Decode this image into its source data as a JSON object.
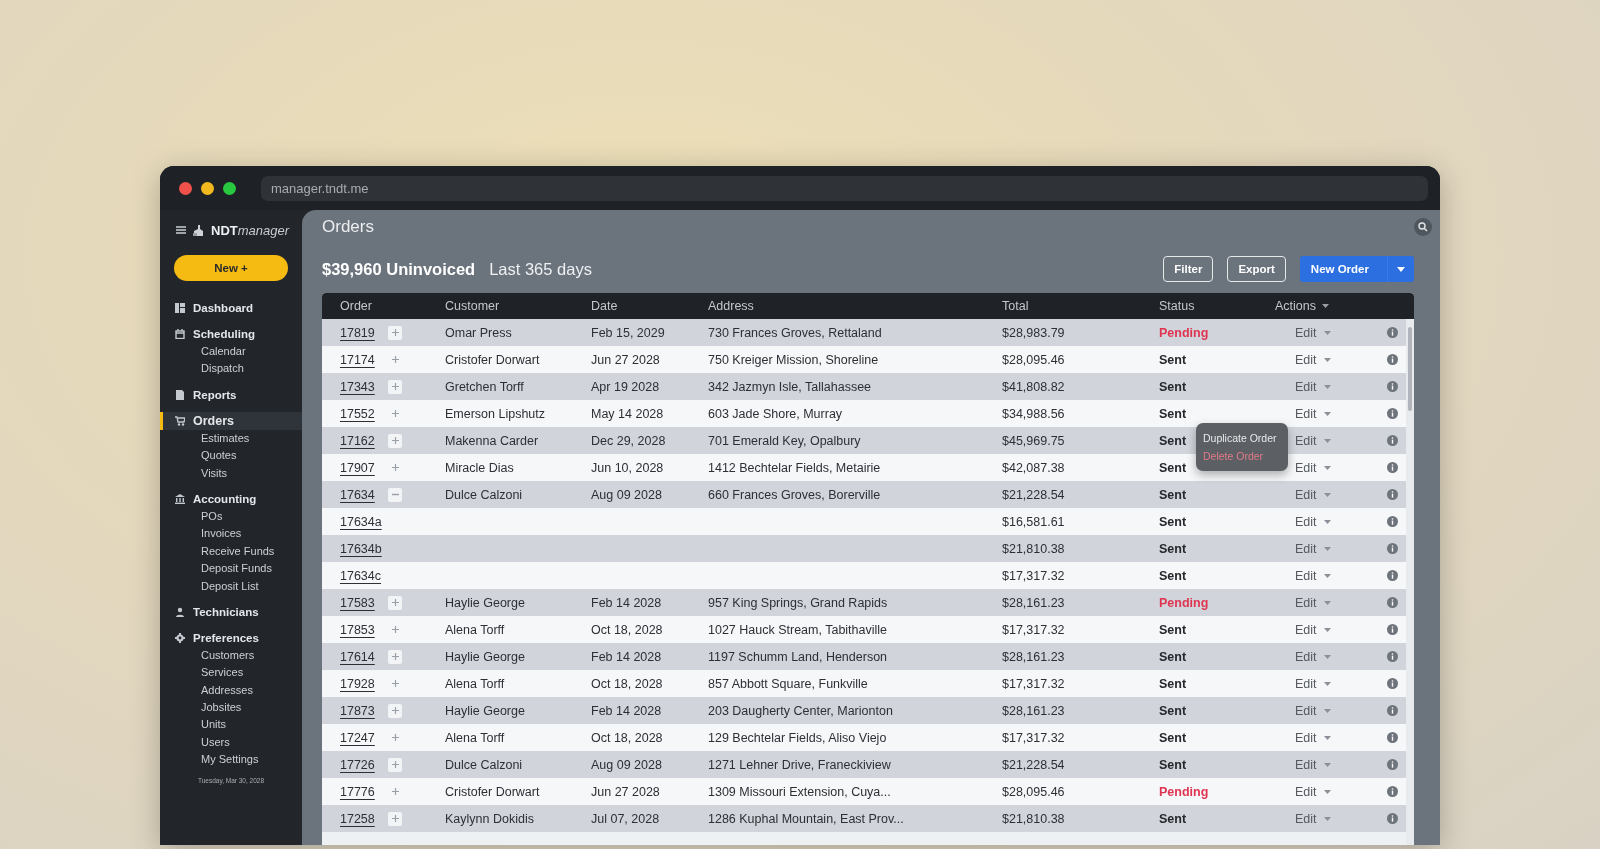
{
  "browser": {
    "address": "manager.tndt.me"
  },
  "sidebar": {
    "brand_bold": "NDT",
    "brand_italic": "manager",
    "new_button": "New +",
    "sections": [
      {
        "kind": "dashboard",
        "label": "Dashboard",
        "selected": false
      },
      {
        "kind": "calendar",
        "label": "Scheduling",
        "selected": false,
        "children": [
          "Calendar",
          "Dispatch"
        ]
      },
      {
        "kind": "report",
        "label": "Reports",
        "selected": false
      },
      {
        "kind": "cart",
        "label": "Orders",
        "selected": true,
        "children": [
          "Estimates",
          "Quotes",
          "Visits"
        ]
      },
      {
        "kind": "bank",
        "label": "Accounting",
        "selected": false,
        "children": [
          "POs",
          "Invoices",
          "Receive Funds",
          "Deposit Funds",
          "Deposit List"
        ]
      },
      {
        "kind": "person",
        "label": "Technicians",
        "selected": false
      },
      {
        "kind": "gear",
        "label": "Preferences",
        "selected": false,
        "children": [
          "Customers",
          "Services",
          "Addresses",
          "Jobsites",
          "Units",
          "Users",
          "My Settings"
        ]
      }
    ],
    "date": "Tuesday, Mar 30, 2028"
  },
  "page": {
    "title": "Orders",
    "summary": "$39,960 Uninvoiced",
    "period": "Last 365 days",
    "buttons": [
      "Filter",
      "Export"
    ],
    "primary_button": "New Order"
  },
  "table": {
    "columns": [
      "Order",
      "Customer",
      "Date",
      "Address",
      "Total",
      "Status",
      "Actions"
    ],
    "rows": [
      {
        "kind": "order",
        "order": "17819",
        "expanded": false,
        "customer": "Omar Press",
        "date": "Feb 15, 2029",
        "address": "730 Frances Groves, Rettaland",
        "total": "$28,983.79",
        "status": "Pending",
        "pending": true,
        "action": "Edit"
      },
      {
        "kind": "order",
        "order": "17174",
        "expanded": false,
        "customer": "Cristofer Dorwart",
        "date": "Jun 27 2028",
        "address": "750 Kreiger Mission, Shoreline",
        "total": "$28,095.46",
        "status": "Sent",
        "pending": false,
        "action": "Edit"
      },
      {
        "kind": "order",
        "order": "17343",
        "expanded": false,
        "customer": "Gretchen Torff",
        "date": "Apr 19 2028",
        "address": "342 Jazmyn Isle, Tallahassee",
        "total": "$41,808.82",
        "status": "Sent",
        "pending": false,
        "action": "Edit"
      },
      {
        "kind": "order",
        "order": "17552",
        "expanded": false,
        "customer": "Emerson Lipshutz",
        "date": "May 14 2028",
        "address": "603 Jade Shore, Murray",
        "total": "$34,988.56",
        "status": "Sent",
        "pending": false,
        "action": "Edit"
      },
      {
        "kind": "order",
        "order": "17162",
        "expanded": false,
        "customer": "Makenna Carder",
        "date": "Dec 29, 2028",
        "address": "701 Emerald Key, Opalbury",
        "total": "$45,969.75",
        "status": "Sent",
        "pending": false,
        "action": "Edit"
      },
      {
        "kind": "order",
        "order": "17907",
        "expanded": false,
        "customer": "Miracle Dias",
        "date": "Jun 10, 2028",
        "address": "1412 Bechtelar Fields, Metairie",
        "total": "$42,087.38",
        "status": "Sent",
        "pending": false,
        "action": "Edit"
      },
      {
        "kind": "order",
        "order": "17634",
        "expanded": true,
        "customer": "Dulce Calzoni",
        "date": "Aug 09 2028",
        "address": "660 Frances Groves, Borerville",
        "total": "$21,228.54",
        "status": "Sent",
        "pending": false,
        "action": "Edit"
      },
      {
        "kind": "sub",
        "order": "17634a",
        "total": "$16,581.61",
        "status": "Sent",
        "pending": false,
        "action": "Edit"
      },
      {
        "kind": "sub",
        "order": "17634b",
        "total": "$21,810.38",
        "status": "Sent",
        "pending": false,
        "action": "Edit"
      },
      {
        "kind": "sub",
        "order": "17634c",
        "total": "$17,317.32",
        "status": "Sent",
        "pending": false,
        "action": "Edit"
      },
      {
        "kind": "order",
        "order": "17583",
        "expanded": false,
        "customer": "Haylie George",
        "date": "Feb 14 2028",
        "address": "957 King Springs, Grand Rapids",
        "total": "$28,161.23",
        "status": "Pending",
        "pending": true,
        "action": "Edit"
      },
      {
        "kind": "order",
        "order": "17853",
        "expanded": false,
        "customer": "Alena Torff",
        "date": "Oct 18, 2028",
        "address": "1027 Hauck Stream, Tabithaville",
        "total": "$17,317.32",
        "status": "Sent",
        "pending": false,
        "action": "Edit"
      },
      {
        "kind": "order",
        "order": "17614",
        "expanded": false,
        "customer": "Haylie George",
        "date": "Feb 14 2028",
        "address": "1197 Schumm Land, Henderson",
        "total": "$28,161.23",
        "status": "Sent",
        "pending": false,
        "action": "Edit"
      },
      {
        "kind": "order",
        "order": "17928",
        "expanded": false,
        "customer": "Alena Torff",
        "date": "Oct 18, 2028",
        "address": "857 Abbott Square, Funkville",
        "total": "$17,317.32",
        "status": "Sent",
        "pending": false,
        "action": "Edit"
      },
      {
        "kind": "order",
        "order": "17873",
        "expanded": false,
        "customer": "Haylie George",
        "date": "Feb 14 2028",
        "address": "203 Daugherty Center, Marionton",
        "total": "$28,161.23",
        "status": "Sent",
        "pending": false,
        "action": "Edit"
      },
      {
        "kind": "order",
        "order": "17247",
        "expanded": false,
        "customer": "Alena Torff",
        "date": "Oct 18, 2028",
        "address": "129 Bechtelar Fields, Aliso Viejo",
        "total": "$17,317.32",
        "status": "Sent",
        "pending": false,
        "action": "Edit"
      },
      {
        "kind": "order",
        "order": "17726",
        "expanded": false,
        "customer": "Dulce Calzoni",
        "date": "Aug 09 2028",
        "address": "1271 Lehner Drive, Franeckiview",
        "total": "$21,228.54",
        "status": "Sent",
        "pending": false,
        "action": "Edit"
      },
      {
        "kind": "order",
        "order": "17776",
        "expanded": false,
        "customer": "Cristofer Dorwart",
        "date": "Jun 27 2028",
        "address": "1309 Missouri Extension, Cuya...",
        "total": "$28,095.46",
        "status": "Pending",
        "pending": true,
        "action": "Edit"
      },
      {
        "kind": "order",
        "order": "17258",
        "expanded": false,
        "customer": "Kaylynn Dokidis",
        "date": "Jul 07, 2028",
        "address": "1286 Kuphal Mountain, East Prov...",
        "total": "$21,810.38",
        "status": "Sent",
        "pending": false,
        "action": "Edit"
      }
    ]
  },
  "context_menu": {
    "items": [
      {
        "label": "Duplicate Order",
        "kind": "normal"
      },
      {
        "label": "Delete Order",
        "kind": "danger"
      }
    ]
  }
}
